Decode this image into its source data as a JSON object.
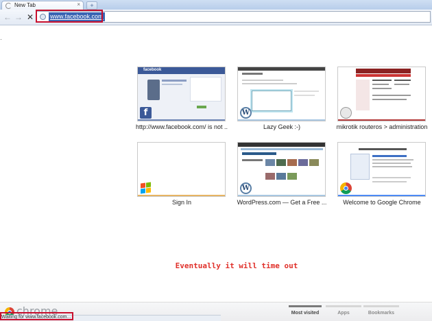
{
  "browser": {
    "tab": {
      "title": "New Tab",
      "close_glyph": "×"
    },
    "new_tab_glyph": "+",
    "nav": {
      "back_glyph": "←",
      "forward_glyph": "→",
      "stop_glyph": "✕"
    },
    "omnibox": {
      "url": "www.facebook.com"
    }
  },
  "thumbnails": [
    {
      "title": "http://www.facebook.com/ is not ...",
      "icon": "facebook-icon",
      "accent": "#6d84b4"
    },
    {
      "title": "Lazy Geek :-)",
      "icon": "wordpress-icon",
      "accent": "#a8c7e2"
    },
    {
      "title": "mikrotik routeros > administration",
      "icon": "mikrotik-icon",
      "accent": "#b33a3a"
    },
    {
      "title": "Sign In",
      "icon": "windows-live-icon",
      "accent": "#e7b463"
    },
    {
      "title": "WordPress.com — Get a Free ...",
      "icon": "wordpress-icon",
      "accent": "#a8c7e2"
    },
    {
      "title": "Welcome to Google Chrome",
      "icon": "chrome-icon",
      "accent": "#4c8bf5"
    }
  ],
  "fb_thumb_text": {
    "brand": "facebook",
    "favicon_letter": "f"
  },
  "wp_thumb_text": {
    "favicon_letter": "W"
  },
  "annotation": "Eventually it will time out",
  "footer": {
    "brand": "chrome",
    "tabs": [
      "Most visited",
      "Apps",
      "Bookmarks"
    ],
    "status": "Waiting for www.facebook.com..."
  },
  "colors": {
    "highlight_box": "#c8102e",
    "annotation_text": "#e0302a",
    "url_selection": "#3a64b3"
  }
}
